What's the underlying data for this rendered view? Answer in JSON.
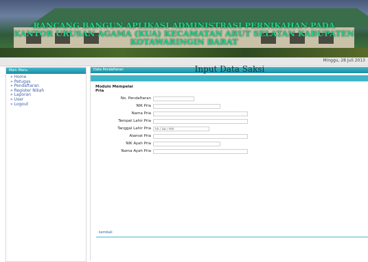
{
  "banner": {
    "line1": "RANCANG BANGUN APLIKASI ADMINISTRASI PERNIKAHAN PADA",
    "line2": "KANTOR URUSAN AGAMA (KUA) KECAMATAN ARUT SELATAN KABUPATEN",
    "line3": "KOTAWARINGIN BARAT"
  },
  "date_text": "Minggu, 28 Juli 2013",
  "sidebar": {
    "title": "Main Menu",
    "items": [
      "» Home",
      "» Petugas",
      "» Pendaftaran",
      "» Register Nikah",
      "» Laporan",
      "» User",
      "» Logout"
    ]
  },
  "main": {
    "header": "Data Pendaftaran",
    "title": "Input Data Saksi",
    "section": [
      "Modulo Mempelai",
      "Pria"
    ],
    "fields": [
      {
        "label": "No. Pendaftaran",
        "value": ""
      },
      {
        "label": "NIK Pria",
        "value": ""
      },
      {
        "label": "Nama Pria",
        "value": ""
      },
      {
        "label": "Tempat Lahir Pria",
        "value": ""
      },
      {
        "label": "Tanggal Lahir Pria",
        "value": "",
        "placeholder": "hh / bb / tttt"
      },
      {
        "label": "Alamat Pria",
        "value": ""
      },
      {
        "label": "NIK Ayah Pria",
        "value": ""
      },
      {
        "label": "Nama Ayah Pria",
        "value": ""
      }
    ],
    "footer_link": "kembali"
  }
}
